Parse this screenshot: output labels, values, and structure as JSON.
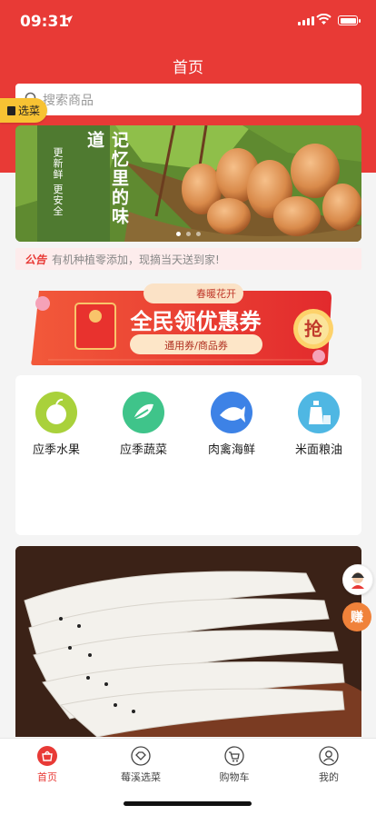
{
  "status_bar": {
    "time": "09:31"
  },
  "header": {
    "title": "首页"
  },
  "search": {
    "placeholder": "搜索商品"
  },
  "floating_tag": {
    "label": "选菜"
  },
  "banner": {
    "big_text": "记忆里的味道",
    "small_text": "更新鲜 更安全",
    "active_dot": 0,
    "dot_count": 3
  },
  "notice": {
    "label": "公告",
    "text": "有机种植零添加，现摘当天送到家!"
  },
  "coupon": {
    "tag": "春暖花开",
    "title": "全民领优惠券",
    "subtitle": "通用券/商品券",
    "action": "抢"
  },
  "categories": [
    {
      "label": "应季水果",
      "icon": "apple-icon",
      "color": "#a9d13b"
    },
    {
      "label": "应季蔬菜",
      "icon": "vegetable-icon",
      "color": "#3fc48a"
    },
    {
      "label": "肉禽海鲜",
      "icon": "fish-icon",
      "color": "#3d82e6"
    },
    {
      "label": "米面粮油",
      "icon": "oil-bottle-icon",
      "color": "#4fb7e3"
    }
  ],
  "floating_buttons": {
    "earn_label": "赚"
  },
  "tabbar": {
    "items": [
      {
        "label": "首页",
        "icon": "shopping-bag-icon"
      },
      {
        "label": "莓溪选菜",
        "icon": "heart-diamond-icon"
      },
      {
        "label": "购物车",
        "icon": "cart-icon"
      },
      {
        "label": "我的",
        "icon": "user-icon"
      }
    ],
    "active_index": 0
  },
  "colors": {
    "brand_red": "#e83a36",
    "accent_yellow": "#f7c233",
    "earn_orange": "#f0823a"
  }
}
